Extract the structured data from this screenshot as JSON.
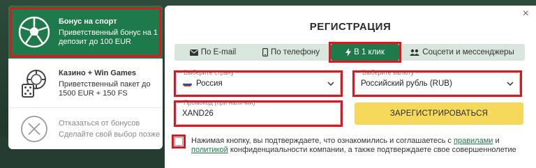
{
  "bonuses": {
    "sport": {
      "title": "Бонус на спорт",
      "desc": "Приветственный бонус на 1 депозит до 100 EUR",
      "icon": "soccer-ball-icon"
    },
    "casino": {
      "title": "Казино + Win Games",
      "desc": "Приветственный пакет до 1500 EUR + 150 FS",
      "icon": "casino-chips-icon"
    },
    "decline": {
      "title": "Отказаться от бонусов",
      "desc": "Сделайте свой выбор позже",
      "icon": "close-circle-icon"
    }
  },
  "modal": {
    "title": "РЕГИСТРАЦИЯ",
    "close": "×",
    "tabs": [
      {
        "label": "По E-mail",
        "icon": "envelope-icon"
      },
      {
        "label": "По телефону",
        "icon": "phone-icon"
      },
      {
        "label": "В 1 клик",
        "icon": "lightning-icon",
        "active": true
      },
      {
        "label": "Соцсети и мессенджеры",
        "icon": "users-icon"
      }
    ],
    "country": {
      "label": "Выберите страну",
      "value": "Россия"
    },
    "currency": {
      "label": "Выберите валюту",
      "value": "Российский рубль (RUB)"
    },
    "promo": {
      "label": "Промокод (при наличии)",
      "value": "XAND26"
    },
    "register_label": "ЗАРЕГИСТРИРОВАТЬСЯ",
    "consent": {
      "before": "Нажимая кнопку, вы подтверждаете, что ознакомились и соглашаетесь с ",
      "rules_link": "правилами",
      "and": " и ",
      "policy_link": "политикой",
      "after": " конфиденциальности компании, а также подтверждаете свое совершеннолетие"
    }
  },
  "colors": {
    "brand_green": "#1e7a4a",
    "highlight_red": "#e3141d",
    "register_yellow": "#f6d95a"
  }
}
